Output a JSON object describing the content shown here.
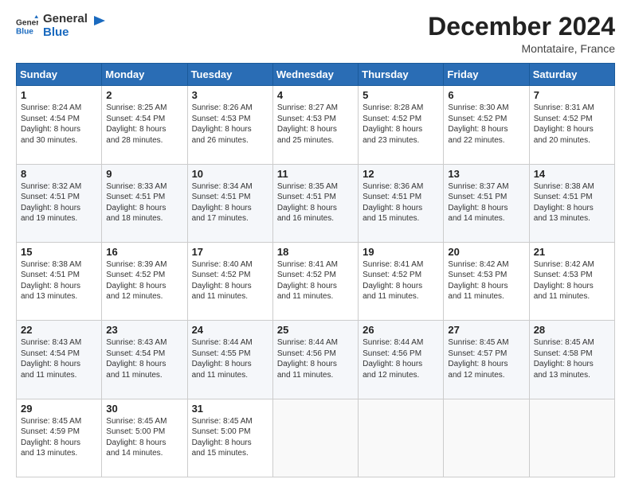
{
  "logo": {
    "general": "General",
    "blue": "Blue"
  },
  "header": {
    "month": "December 2024",
    "location": "Montataire, France"
  },
  "days_of_week": [
    "Sunday",
    "Monday",
    "Tuesday",
    "Wednesday",
    "Thursday",
    "Friday",
    "Saturday"
  ],
  "weeks": [
    [
      {
        "day": "1",
        "sunrise": "8:24 AM",
        "sunset": "4:54 PM",
        "daylight": "8 hours and 30 minutes."
      },
      {
        "day": "2",
        "sunrise": "8:25 AM",
        "sunset": "4:54 PM",
        "daylight": "8 hours and 28 minutes."
      },
      {
        "day": "3",
        "sunrise": "8:26 AM",
        "sunset": "4:53 PM",
        "daylight": "8 hours and 26 minutes."
      },
      {
        "day": "4",
        "sunrise": "8:27 AM",
        "sunset": "4:53 PM",
        "daylight": "8 hours and 25 minutes."
      },
      {
        "day": "5",
        "sunrise": "8:28 AM",
        "sunset": "4:52 PM",
        "daylight": "8 hours and 23 minutes."
      },
      {
        "day": "6",
        "sunrise": "8:30 AM",
        "sunset": "4:52 PM",
        "daylight": "8 hours and 22 minutes."
      },
      {
        "day": "7",
        "sunrise": "8:31 AM",
        "sunset": "4:52 PM",
        "daylight": "8 hours and 20 minutes."
      }
    ],
    [
      {
        "day": "8",
        "sunrise": "8:32 AM",
        "sunset": "4:51 PM",
        "daylight": "8 hours and 19 minutes."
      },
      {
        "day": "9",
        "sunrise": "8:33 AM",
        "sunset": "4:51 PM",
        "daylight": "8 hours and 18 minutes."
      },
      {
        "day": "10",
        "sunrise": "8:34 AM",
        "sunset": "4:51 PM",
        "daylight": "8 hours and 17 minutes."
      },
      {
        "day": "11",
        "sunrise": "8:35 AM",
        "sunset": "4:51 PM",
        "daylight": "8 hours and 16 minutes."
      },
      {
        "day": "12",
        "sunrise": "8:36 AM",
        "sunset": "4:51 PM",
        "daylight": "8 hours and 15 minutes."
      },
      {
        "day": "13",
        "sunrise": "8:37 AM",
        "sunset": "4:51 PM",
        "daylight": "8 hours and 14 minutes."
      },
      {
        "day": "14",
        "sunrise": "8:38 AM",
        "sunset": "4:51 PM",
        "daylight": "8 hours and 13 minutes."
      }
    ],
    [
      {
        "day": "15",
        "sunrise": "8:38 AM",
        "sunset": "4:51 PM",
        "daylight": "8 hours and 13 minutes."
      },
      {
        "day": "16",
        "sunrise": "8:39 AM",
        "sunset": "4:52 PM",
        "daylight": "8 hours and 12 minutes."
      },
      {
        "day": "17",
        "sunrise": "8:40 AM",
        "sunset": "4:52 PM",
        "daylight": "8 hours and 11 minutes."
      },
      {
        "day": "18",
        "sunrise": "8:41 AM",
        "sunset": "4:52 PM",
        "daylight": "8 hours and 11 minutes."
      },
      {
        "day": "19",
        "sunrise": "8:41 AM",
        "sunset": "4:52 PM",
        "daylight": "8 hours and 11 minutes."
      },
      {
        "day": "20",
        "sunrise": "8:42 AM",
        "sunset": "4:53 PM",
        "daylight": "8 hours and 11 minutes."
      },
      {
        "day": "21",
        "sunrise": "8:42 AM",
        "sunset": "4:53 PM",
        "daylight": "8 hours and 11 minutes."
      }
    ],
    [
      {
        "day": "22",
        "sunrise": "8:43 AM",
        "sunset": "4:54 PM",
        "daylight": "8 hours and 11 minutes."
      },
      {
        "day": "23",
        "sunrise": "8:43 AM",
        "sunset": "4:54 PM",
        "daylight": "8 hours and 11 minutes."
      },
      {
        "day": "24",
        "sunrise": "8:44 AM",
        "sunset": "4:55 PM",
        "daylight": "8 hours and 11 minutes."
      },
      {
        "day": "25",
        "sunrise": "8:44 AM",
        "sunset": "4:56 PM",
        "daylight": "8 hours and 11 minutes."
      },
      {
        "day": "26",
        "sunrise": "8:44 AM",
        "sunset": "4:56 PM",
        "daylight": "8 hours and 12 minutes."
      },
      {
        "day": "27",
        "sunrise": "8:45 AM",
        "sunset": "4:57 PM",
        "daylight": "8 hours and 12 minutes."
      },
      {
        "day": "28",
        "sunrise": "8:45 AM",
        "sunset": "4:58 PM",
        "daylight": "8 hours and 13 minutes."
      }
    ],
    [
      {
        "day": "29",
        "sunrise": "8:45 AM",
        "sunset": "4:59 PM",
        "daylight": "8 hours and 13 minutes."
      },
      {
        "day": "30",
        "sunrise": "8:45 AM",
        "sunset": "5:00 PM",
        "daylight": "8 hours and 14 minutes."
      },
      {
        "day": "31",
        "sunrise": "8:45 AM",
        "sunset": "5:00 PM",
        "daylight": "8 hours and 15 minutes."
      },
      null,
      null,
      null,
      null
    ]
  ],
  "labels": {
    "sunrise": "Sunrise:",
    "sunset": "Sunset:",
    "daylight": "Daylight hours"
  }
}
